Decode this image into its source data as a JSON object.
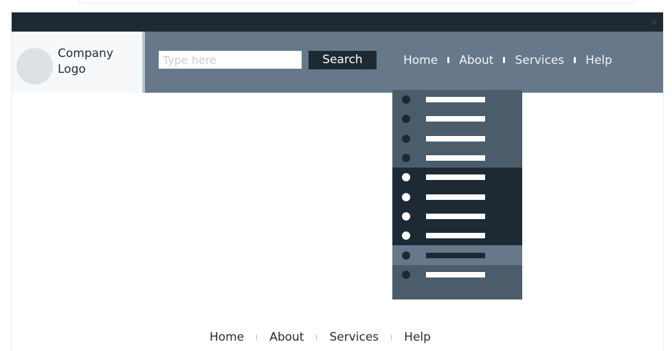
{
  "window": {
    "close_glyph": "×"
  },
  "brand": {
    "logo_text": "Company\nLogo"
  },
  "search": {
    "placeholder": "Type here",
    "button_label": "Search"
  },
  "nav": {
    "links": [
      "Home",
      "About",
      "Services",
      "Help"
    ]
  },
  "dropdown": {
    "items": [
      {
        "style": "normal"
      },
      {
        "style": "normal"
      },
      {
        "style": "normal"
      },
      {
        "style": "normal"
      },
      {
        "style": "dark"
      },
      {
        "style": "dark"
      },
      {
        "style": "dark"
      },
      {
        "style": "dark"
      },
      {
        "style": "hover"
      },
      {
        "style": "normal"
      }
    ]
  },
  "footer": {
    "links": [
      "Home",
      "About",
      "Services",
      "Help"
    ]
  },
  "colors": {
    "titlebar": "#1e2a33",
    "navbar": "#66788a",
    "dropdown_normal": "#4b5c6b",
    "dropdown_dark": "#1e2a33",
    "dropdown_hover": "#66788a"
  }
}
